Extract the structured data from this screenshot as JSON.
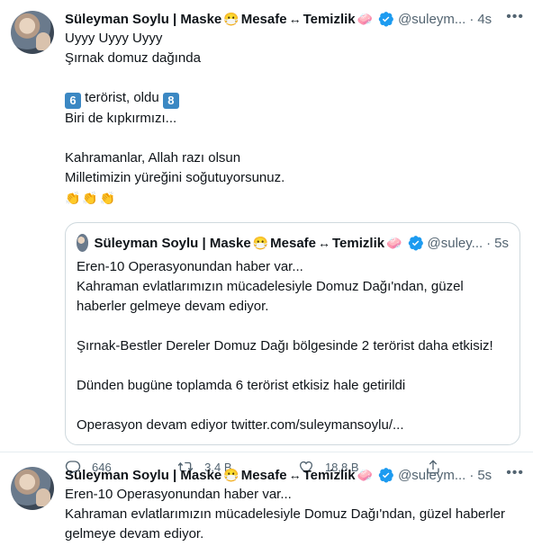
{
  "tweet1": {
    "author": {
      "name": "Süleyman Soylu | Maske",
      "emoji_mask": "😷",
      "name_mid": " Mesafe",
      "emoji_arrow": "↔",
      "name_end": " Temizlik",
      "emoji_soap": "🧼",
      "handle": "@suleym...",
      "time": "4s"
    },
    "lines": {
      "l1": "Uyyy Uyyy Uyyy",
      "l2": "Şırnak domuz dağında",
      "l3_pre": "6",
      "l3_mid": " terörist, oldu ",
      "l3_post": "8",
      "l4": "Biri de kıpkırmızı...",
      "l5": "Kahramanlar, Allah razı olsun",
      "l6": "Milletimizin yüreğini soğutuyorsunuz.",
      "l7": "👏👏👏"
    },
    "quote": {
      "name": "Süleyman Soylu | Maske",
      "emoji_mask": "😷",
      "name_mid": " Mesafe",
      "emoji_arrow": "↔",
      "name_end": " Temizlik",
      "emoji_soap": "🧼",
      "handle": "@suley...",
      "time": "5s",
      "p1": "Eren-10 Operasyonundan haber var...\nKahraman evlatlarımızın mücadelesiyle Domuz Dağı'ndan, güzel haberler gelmeye devam ediyor.",
      "p2": "Şırnak-Bestler Dereler Domuz Dağı bölgesinde 2 terörist daha etkisiz!",
      "p3": "Dünden bugüne toplamda 6 terörist etkisiz hale getirildi",
      "p4": "Operasyon devam ediyor twitter.com/suleymansoylu/..."
    },
    "actions": {
      "replies": "646",
      "retweets": "3,4 B",
      "likes": "18,8 B"
    }
  },
  "tweet2": {
    "author": {
      "name": "Süleyman Soylu | Maske",
      "emoji_mask": "😷",
      "name_mid": " Mesafe",
      "emoji_arrow": "↔",
      "name_end": " Temizlik",
      "emoji_soap": "🧼",
      "handle": "@suleym...",
      "time": "5s"
    },
    "text": "Eren-10 Operasyonundan haber var...\nKahraman evlatlarımızın mücadelesiyle Domuz Dağı'ndan, güzel haberler gelmeye devam ediyor."
  },
  "colors": {
    "verified": "#1d9bf0",
    "keycap": "#3b88c3",
    "secondary_text": "#536471",
    "border": "#cfd9de"
  },
  "icons": [
    "reply-icon",
    "retweet-icon",
    "like-icon",
    "share-icon",
    "verified-badge-icon",
    "more-options-icon"
  ]
}
